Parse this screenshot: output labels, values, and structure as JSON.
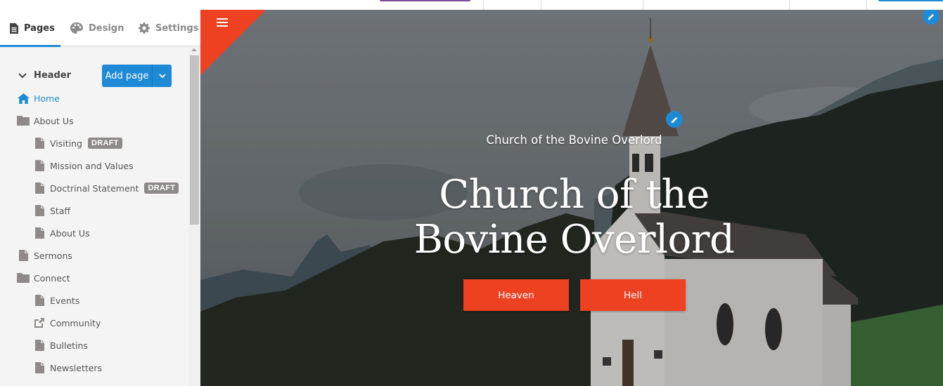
{
  "sidebar": {
    "tabs": [
      {
        "label": "Pages",
        "icon": "document-icon",
        "active": true
      },
      {
        "label": "Design",
        "icon": "palette-icon",
        "active": false
      },
      {
        "label": "Settings",
        "icon": "gear-icon",
        "active": false
      }
    ],
    "section": {
      "label": "Header",
      "add_page_label": "Add page"
    },
    "pages": [
      {
        "label": "Home",
        "icon": "home-icon",
        "level": 0,
        "active": true
      },
      {
        "label": "About Us",
        "icon": "folder-icon",
        "level": 0
      },
      {
        "label": "Visiting",
        "icon": "page-icon",
        "level": 1,
        "badge": "DRAFT"
      },
      {
        "label": "Mission and Values",
        "icon": "page-icon",
        "level": 1
      },
      {
        "label": "Doctrinal Statement",
        "icon": "page-icon",
        "level": 1,
        "badge": "DRAFT"
      },
      {
        "label": "Staff",
        "icon": "page-icon",
        "level": 1
      },
      {
        "label": "About Us",
        "icon": "page-icon",
        "level": 1
      },
      {
        "label": "Sermons",
        "icon": "page-icon",
        "level": 0
      },
      {
        "label": "Connect",
        "icon": "folder-icon",
        "level": 0
      },
      {
        "label": "Events",
        "icon": "page-icon",
        "level": 1
      },
      {
        "label": "Community",
        "icon": "external-link-icon",
        "level": 1
      },
      {
        "label": "Bulletins",
        "icon": "page-icon",
        "level": 1
      },
      {
        "label": "Newsletters",
        "icon": "page-icon",
        "level": 1
      }
    ]
  },
  "hero": {
    "subtitle": "Church of the Bovine Overlord",
    "title_line1": "Church of the",
    "title_line2": "Bovine Overlord",
    "buttons": [
      "Heaven",
      "Hell"
    ]
  },
  "colors": {
    "accent_blue": "#1e8ad6",
    "accent_red": "#ee4122",
    "draft_badge": "#8e8a8a"
  }
}
